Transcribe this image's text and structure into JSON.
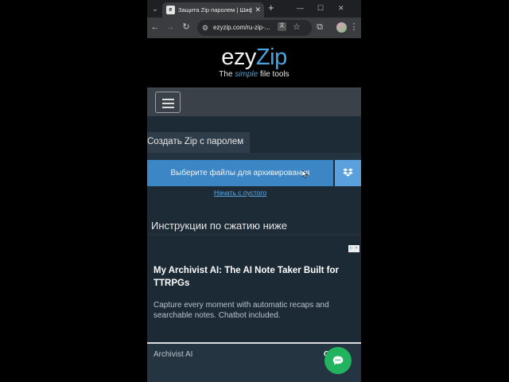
{
  "browser": {
    "tab_title": "Защита Zip паролем | Шифров",
    "tab_favicon": "e",
    "url": "ezyzip.com/ru-zip-...",
    "translate_glyph": "文"
  },
  "site": {
    "logo_left": "ezy",
    "logo_right": "Zip",
    "tagline_pre": "The ",
    "tagline_accent": "simple",
    "tagline_post": " file tools",
    "accent_color": "#4aa3df"
  },
  "tool": {
    "section_tab": "Создать Zip с паролем",
    "upload_button": "Выберите файлы для архивирования",
    "start_empty": "Начать с пустого",
    "instructions_heading": "Инструкции по сжатию ниже"
  },
  "ad": {
    "title": "My Archivist AI: The AI Note Taker Built for TTRPGs",
    "description": "Capture every moment with automatic recaps and searchable notes. Chatbot included.",
    "advertiser": "Archivist AI",
    "open_label": "O"
  },
  "icons": {
    "tab_menu": "chevron-down-icon",
    "close": "close-icon",
    "new_tab": "plus-icon",
    "back": "back-arrow-icon",
    "forward": "forward-arrow-icon",
    "reload": "reload-icon",
    "site_info": "tune-icon",
    "bookmark": "star-icon",
    "extensions": "puzzle-icon",
    "menu": "more-vertical-icon",
    "dropbox": "dropbox-icon",
    "chat": "chat-icon"
  }
}
